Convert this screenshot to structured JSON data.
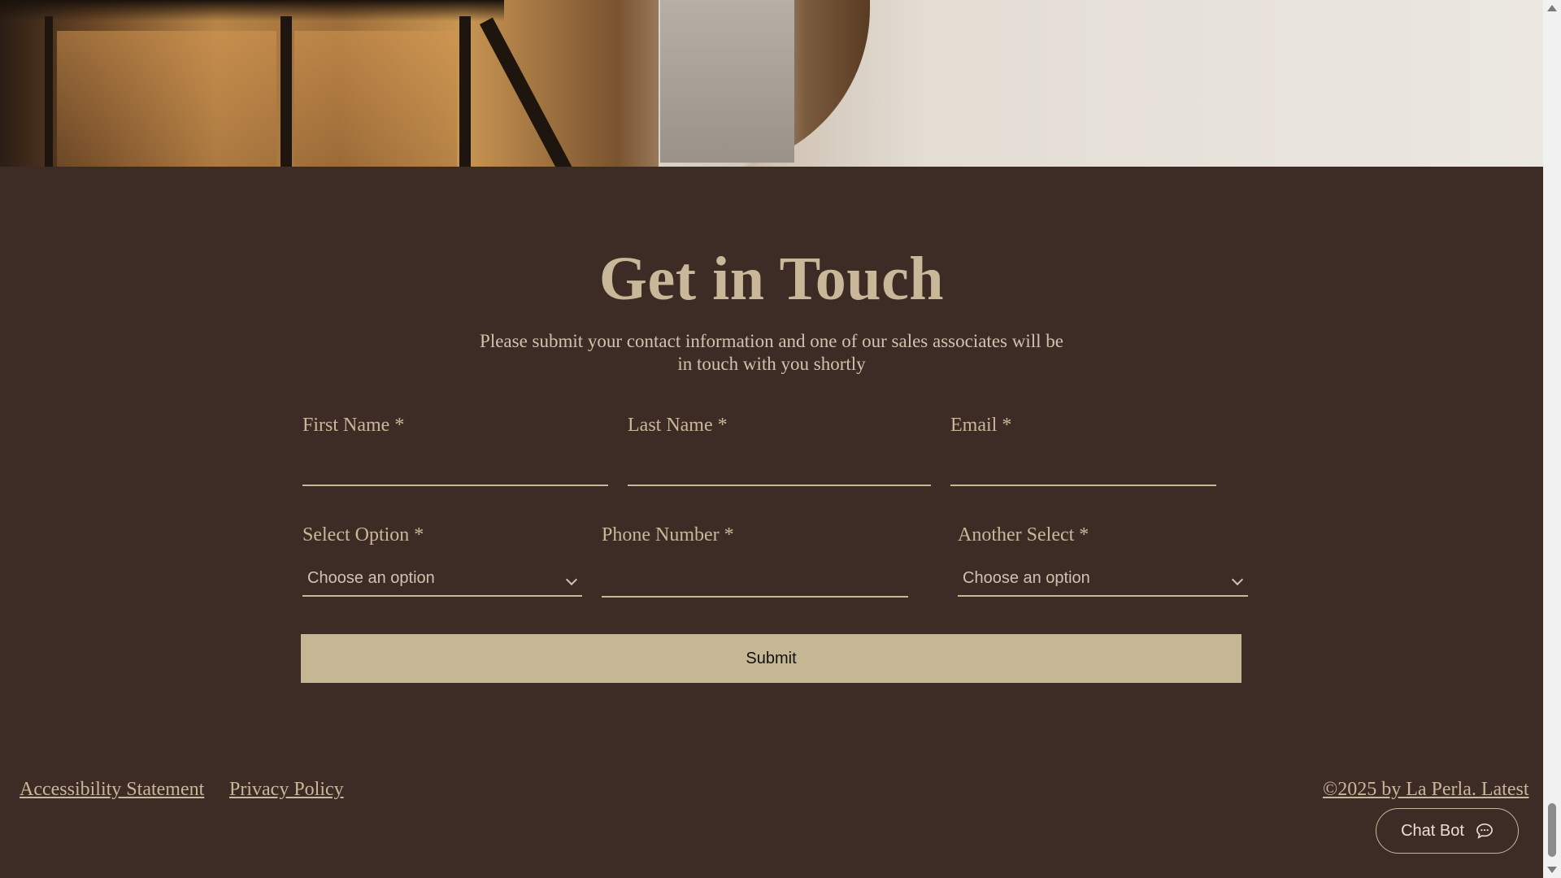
{
  "contact": {
    "heading": "Get in Touch",
    "subtitle_line1": "Please submit your contact information and one of our sales associates will be",
    "subtitle_line2": "in touch with you shortly"
  },
  "form": {
    "first_name_label": "First Name *",
    "last_name_label": "Last Name *",
    "email_label": "Email *",
    "select_option_label": "Select Option *",
    "select_option_value": "Choose an option",
    "phone_label": "Phone Number *",
    "another_select_label": "Another Select *",
    "another_select_value": "Choose an option",
    "submit_label": "Submit"
  },
  "footer": {
    "accessibility": "Accessibility Statement",
    "privacy": "Privacy Policy",
    "copyright": "©2025 by La Perla. Latest"
  },
  "chatbot": {
    "label": "Chat Bot",
    "icon": "chat-bubble-icon"
  },
  "colors": {
    "background": "#3d2b25",
    "accent": "#c8b799",
    "button": "#c5b694"
  }
}
